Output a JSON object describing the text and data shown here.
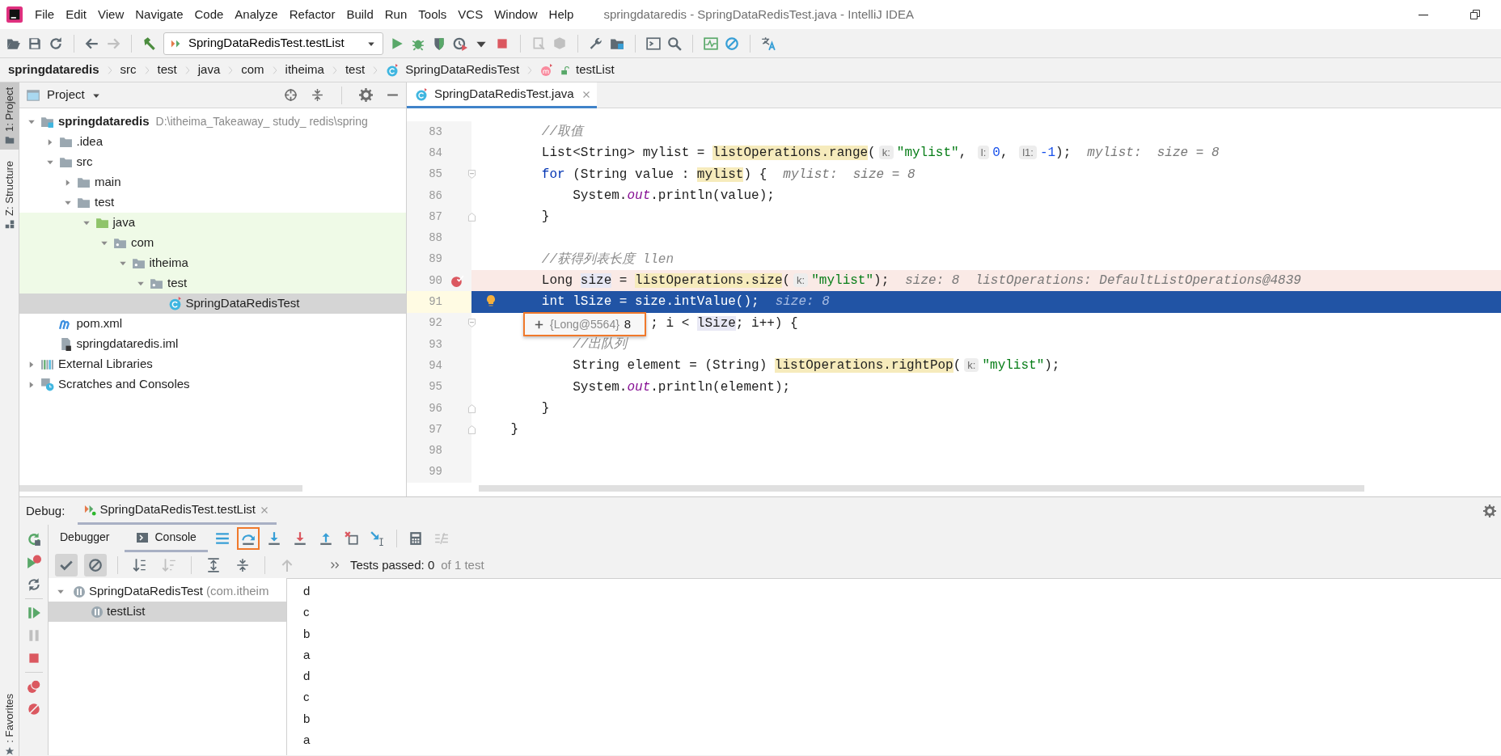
{
  "menu_bar": {
    "items": [
      "File",
      "Edit",
      "View",
      "Navigate",
      "Code",
      "Analyze",
      "Refactor",
      "Build",
      "Run",
      "Tools",
      "VCS",
      "Window",
      "Help"
    ],
    "title": "springdataredis - SpringDataRedisTest.java - IntelliJ IDEA"
  },
  "toolbar": {
    "run_configuration": "SpringDataRedisTest.testList"
  },
  "breadcrumbs": [
    {
      "label": "springdataredis",
      "kind": "project"
    },
    {
      "label": "src",
      "kind": "folder"
    },
    {
      "label": "test",
      "kind": "folder"
    },
    {
      "label": "java",
      "kind": "folder"
    },
    {
      "label": "com",
      "kind": "folder"
    },
    {
      "label": "itheima",
      "kind": "folder"
    },
    {
      "label": "test",
      "kind": "folder"
    },
    {
      "label": "SpringDataRedisTest",
      "kind": "class"
    },
    {
      "label": "testList",
      "kind": "method"
    }
  ],
  "tool_stripe": {
    "top": [
      {
        "label": "1: Project",
        "kind": "project",
        "selected": true
      },
      {
        "label": "Z: Structure",
        "kind": "structure",
        "selected": false
      }
    ],
    "bottom": [
      {
        "label": ": Favorites",
        "kind": "favorites",
        "selected": false
      }
    ]
  },
  "project": {
    "title": "Project",
    "tree": [
      {
        "label": "springdataredis",
        "path": "D:\\itheima_Takeaway_ study_ redis\\spring",
        "kind": "module",
        "expanded": true,
        "selected": false,
        "test_scope": false,
        "children": [
          {
            "label": ".idea",
            "kind": "folder",
            "expanded": false,
            "selected": false,
            "test_scope": false
          },
          {
            "label": "src",
            "kind": "folder",
            "expanded": true,
            "selected": false,
            "test_scope": false,
            "children": [
              {
                "label": "main",
                "kind": "folder",
                "expanded": false,
                "selected": false,
                "test_scope": false
              },
              {
                "label": "test",
                "kind": "folder",
                "expanded": true,
                "selected": false,
                "test_scope": false,
                "children": [
                  {
                    "label": "java",
                    "kind": "source-folder",
                    "expanded": true,
                    "selected": false,
                    "test_scope": true,
                    "children": [
                      {
                        "label": "com",
                        "kind": "package",
                        "expanded": true,
                        "selected": false,
                        "test_scope": true,
                        "children": [
                          {
                            "label": "itheima",
                            "kind": "package",
                            "expanded": true,
                            "selected": false,
                            "test_scope": true,
                            "children": [
                              {
                                "label": "test",
                                "kind": "package",
                                "expanded": true,
                                "selected": false,
                                "test_scope": true,
                                "children": [
                                  {
                                    "label": "SpringDataRedisTest",
                                    "kind": "class",
                                    "selected": true,
                                    "test_scope": false
                                  }
                                ]
                              }
                            ]
                          }
                        ]
                      }
                    ]
                  }
                ]
              }
            ]
          },
          {
            "label": "pom.xml",
            "kind": "maven",
            "selected": false,
            "test_scope": false
          },
          {
            "label": "springdataredis.iml",
            "kind": "iml",
            "selected": false,
            "test_scope": false
          }
        ]
      },
      {
        "label": "External Libraries",
        "kind": "libraries",
        "expanded": false,
        "selected": false,
        "test_scope": false
      },
      {
        "label": "Scratches and Consoles",
        "kind": "scratches",
        "expanded": false,
        "selected": false,
        "test_scope": false
      }
    ]
  },
  "editor": {
    "tabs": [
      {
        "label": "SpringDataRedisTest.java",
        "selected": true
      }
    ],
    "lines": [
      {
        "number": "83",
        "breakpoint": false,
        "execution_point": false,
        "fold_start": false,
        "fold_end": false,
        "segments": [
          {
            "text": "        //取值",
            "kind": "comment"
          }
        ]
      },
      {
        "number": "84",
        "breakpoint": false,
        "execution_point": false,
        "fold_start": false,
        "fold_end": false,
        "segments": [
          {
            "text": "        List<String> mylist = ",
            "kind": "plain"
          },
          {
            "text": "listOperations.range",
            "kind": "method"
          },
          {
            "text": "(",
            "kind": "plain"
          },
          {
            "text": "k:",
            "kind": "hint"
          },
          {
            "text": "\"mylist\"",
            "kind": "string"
          },
          {
            "text": ", ",
            "kind": "plain"
          },
          {
            "text": "l:",
            "kind": "hint"
          },
          {
            "text": "0",
            "kind": "number"
          },
          {
            "text": ", ",
            "kind": "plain"
          },
          {
            "text": "l1:",
            "kind": "hint"
          },
          {
            "text": "-1",
            "kind": "number"
          },
          {
            "text": ");",
            "kind": "plain"
          },
          {
            "text": "mylist:  size = 8",
            "kind": "value"
          }
        ]
      },
      {
        "number": "85",
        "breakpoint": false,
        "execution_point": false,
        "fold_start": true,
        "fold_end": false,
        "segments": [
          {
            "text": "        for",
            "kind": "keyword"
          },
          {
            "text": " (String value : ",
            "kind": "plain"
          },
          {
            "text": "mylist",
            "kind": "method"
          },
          {
            "text": ") {",
            "kind": "plain"
          },
          {
            "text": "mylist:  size = 8",
            "kind": "value"
          }
        ]
      },
      {
        "number": "86",
        "breakpoint": false,
        "execution_point": false,
        "fold_start": false,
        "fold_end": false,
        "segments": [
          {
            "text": "            System.",
            "kind": "plain"
          },
          {
            "text": "out",
            "kind": "static"
          },
          {
            "text": ".println(value);",
            "kind": "plain"
          }
        ]
      },
      {
        "number": "87",
        "breakpoint": false,
        "execution_point": false,
        "fold_start": false,
        "fold_end": true,
        "segments": [
          {
            "text": "        }",
            "kind": "plain"
          }
        ]
      },
      {
        "number": "88",
        "breakpoint": false,
        "execution_point": false,
        "fold_start": false,
        "fold_end": false
      },
      {
        "number": "89",
        "breakpoint": false,
        "execution_point": false,
        "fold_start": false,
        "fold_end": false,
        "segments": [
          {
            "text": "        //获得列表长度 llen",
            "kind": "comment"
          }
        ]
      },
      {
        "number": "90",
        "breakpoint": true,
        "execution_point": false,
        "fold_start": false,
        "fold_end": false,
        "segments": [
          {
            "text": "        Long ",
            "kind": "plain"
          },
          {
            "text": "size",
            "kind": "usage"
          },
          {
            "text": " = ",
            "kind": "plain"
          },
          {
            "text": "listOperations.size",
            "kind": "method"
          },
          {
            "text": "(",
            "kind": "plain"
          },
          {
            "text": "k:",
            "kind": "hint"
          },
          {
            "text": "\"mylist\"",
            "kind": "string"
          },
          {
            "text": ");",
            "kind": "plain"
          },
          {
            "text": "size: 8  listOperations: DefaultListOperations@4839",
            "kind": "value"
          }
        ]
      },
      {
        "number": "91",
        "breakpoint": false,
        "execution_point": true,
        "intention_bulb": true,
        "fold_start": false,
        "fold_end": false,
        "segments": [
          {
            "text": "        int lSize = size.intValue();",
            "kind": "plain"
          },
          {
            "text": "size: 8",
            "kind": "value"
          }
        ]
      },
      {
        "number": "92",
        "breakpoint": false,
        "execution_point": false,
        "fold_start": true,
        "fold_end": false,
        "segments": [
          {
            "text": "                      ; i < ",
            "kind": "plain"
          },
          {
            "text": "lSize",
            "kind": "usage"
          },
          {
            "text": "; i++) {",
            "kind": "plain"
          }
        ]
      },
      {
        "number": "93",
        "breakpoint": false,
        "execution_point": false,
        "fold_start": false,
        "fold_end": false,
        "segments": [
          {
            "text": "            //出队列",
            "kind": "comment"
          }
        ]
      },
      {
        "number": "94",
        "breakpoint": false,
        "execution_point": false,
        "fold_start": false,
        "fold_end": false,
        "segments": [
          {
            "text": "            String element = (String) ",
            "kind": "plain"
          },
          {
            "text": "listOperations.rightPop",
            "kind": "method"
          },
          {
            "text": "(",
            "kind": "plain"
          },
          {
            "text": "k:",
            "kind": "hint"
          },
          {
            "text": "\"mylist\"",
            "kind": "string"
          },
          {
            "text": ");",
            "kind": "plain"
          }
        ]
      },
      {
        "number": "95",
        "breakpoint": false,
        "execution_point": false,
        "fold_start": false,
        "fold_end": false,
        "segments": [
          {
            "text": "            System.",
            "kind": "plain"
          },
          {
            "text": "out",
            "kind": "static"
          },
          {
            "text": ".println(element);",
            "kind": "plain"
          }
        ]
      },
      {
        "number": "96",
        "breakpoint": false,
        "execution_point": false,
        "fold_start": false,
        "fold_end": true,
        "segments": [
          {
            "text": "        }",
            "kind": "plain"
          }
        ]
      },
      {
        "number": "97",
        "breakpoint": false,
        "execution_point": false,
        "fold_start": false,
        "fold_end": true,
        "segments": [
          {
            "text": "    }",
            "kind": "plain"
          }
        ]
      },
      {
        "number": "98",
        "breakpoint": false,
        "execution_point": false,
        "fold_start": false,
        "fold_end": false
      },
      {
        "number": "99",
        "breakpoint": false,
        "execution_point": false,
        "fold_start": false,
        "fold_end": false
      }
    ],
    "tooltip": {
      "object": "{Long@5564}",
      "value": "8",
      "annotated": true
    }
  },
  "debug": {
    "label": "Debug:",
    "session_tab": {
      "label": "SpringDataRedisTest.testList",
      "selected": true
    },
    "view_tabs": [
      {
        "label": "Debugger",
        "selected": false
      },
      {
        "label": "Console",
        "selected": true
      }
    ],
    "step_over_annotated": true,
    "filter_toggles": [
      {
        "kind": "passed",
        "pressed": true
      },
      {
        "kind": "ignored",
        "pressed": true
      }
    ],
    "test_status": {
      "passed": "Tests passed: 0",
      "total": "of 1 test"
    },
    "test_tree": [
      {
        "label": "SpringDataRedisTest",
        "detail": "(com.itheim",
        "expanded": true,
        "selected": false,
        "children": [
          {
            "label": "testList",
            "selected": true
          }
        ]
      }
    ],
    "console": [
      "d",
      "c",
      "b",
      "a",
      "d",
      "c",
      "b",
      "a"
    ]
  }
}
